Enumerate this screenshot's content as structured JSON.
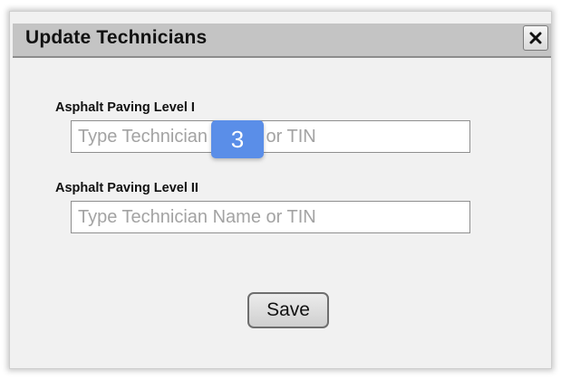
{
  "dialog": {
    "title": "Update Technicians",
    "close_icon": "close-icon"
  },
  "fields": [
    {
      "label": "Asphalt Paving Level I",
      "value": "",
      "placeholder": "Type Technician Name or TIN"
    },
    {
      "label": "Asphalt Paving Level II",
      "value": "",
      "placeholder": "Type Technician Name or TIN"
    }
  ],
  "overlay_badge": "3",
  "actions": {
    "save_label": "Save"
  },
  "colors": {
    "titlebar": "#c4c4c4",
    "dialog_bg": "#f1f1f1",
    "badge": "#5a8ee8"
  }
}
